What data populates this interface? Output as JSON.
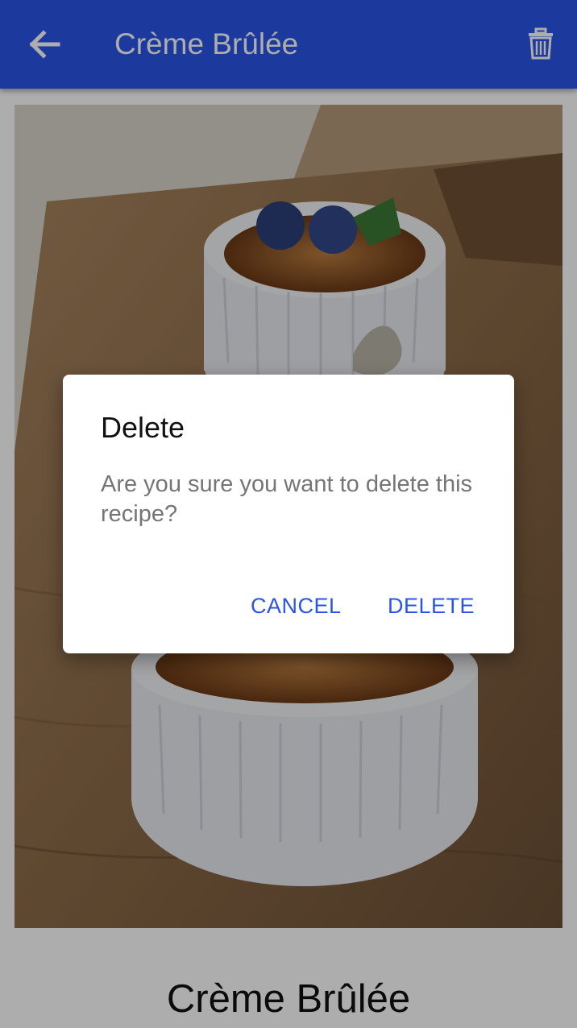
{
  "appbar": {
    "title": "Crème Brûlée",
    "back_icon": "arrow-left-icon",
    "delete_icon": "trash-icon",
    "color": "#2a54e8"
  },
  "recipe": {
    "name": "Crème Brûlée",
    "image": "creme-brulee-photo"
  },
  "dialog": {
    "title": "Delete",
    "message": "Are you sure you want to delete this recipe?",
    "cancel_label": "CANCEL",
    "delete_label": "DELETE",
    "accent": "#2a54e8"
  }
}
